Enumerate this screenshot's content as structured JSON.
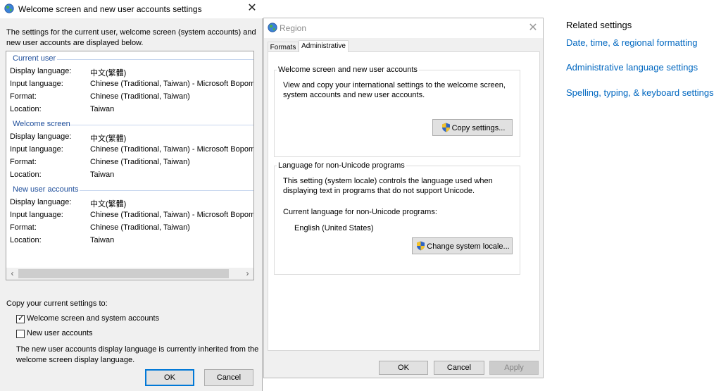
{
  "welcome_dialog": {
    "title": "Welcome screen and new user accounts settings",
    "close_glyph": "✕",
    "intro": "The settings for the current user, welcome screen (system accounts) and new user accounts are displayed below.",
    "sections": [
      {
        "header": "Current user",
        "rows": [
          {
            "label": "Display language:",
            "value": "中文(繁體)"
          },
          {
            "label": "Input language:",
            "value": "Chinese (Traditional, Taiwan) - Microsoft Bopomo"
          },
          {
            "label": "Format:",
            "value": "Chinese (Traditional, Taiwan)"
          },
          {
            "label": "Location:",
            "value": "Taiwan"
          }
        ]
      },
      {
        "header": "Welcome screen",
        "rows": [
          {
            "label": "Display language:",
            "value": "中文(繁體)"
          },
          {
            "label": "Input language:",
            "value": "Chinese (Traditional, Taiwan) - Microsoft Bopomo"
          },
          {
            "label": "Format:",
            "value": "Chinese (Traditional, Taiwan)"
          },
          {
            "label": "Location:",
            "value": "Taiwan"
          }
        ]
      },
      {
        "header": "New user accounts",
        "rows": [
          {
            "label": "Display language:",
            "value": "中文(繁體)"
          },
          {
            "label": "Input language:",
            "value": "Chinese (Traditional, Taiwan) - Microsoft Bopomo"
          },
          {
            "label": "Format:",
            "value": "Chinese (Traditional, Taiwan)"
          },
          {
            "label": "Location:",
            "value": "Taiwan"
          }
        ]
      }
    ],
    "scroll_left": "‹",
    "scroll_right": "›",
    "copy_heading": "Copy your current settings to:",
    "checkbox_welcome": {
      "label": "Welcome screen and system accounts",
      "checked": true,
      "mark": "✓"
    },
    "checkbox_new_users": {
      "label": "New user accounts",
      "checked": false
    },
    "note": "The new user accounts display language is currently inherited from the welcome screen display language.",
    "ok_label": "OK",
    "cancel_label": "Cancel"
  },
  "region_dialog": {
    "title": "Region",
    "close_glyph": "✕",
    "tabs": [
      {
        "label": "Formats",
        "active": false
      },
      {
        "label": "Administrative",
        "active": true
      }
    ],
    "welcome_group": {
      "title": "Welcome screen and new user accounts",
      "text": "View and copy your international settings to the welcome screen, system accounts and new user accounts.",
      "button": "Copy settings..."
    },
    "unicode_group": {
      "title": "Language for non-Unicode programs",
      "text": "This setting (system locale) controls the language used when displaying text in programs that do not support Unicode.",
      "current_label": "Current language for non-Unicode programs:",
      "current_value": "English (United States)",
      "button": "Change system locale..."
    },
    "ok_label": "OK",
    "cancel_label": "Cancel",
    "apply_label": "Apply"
  },
  "related_settings": {
    "heading": "Related settings",
    "links": [
      "Date, time, & regional formatting",
      "Administrative language settings",
      "Spelling, typing, & keyboard settings"
    ]
  },
  "colors": {
    "link": "#0067c0",
    "section_header": "#1e4e9b",
    "default_button_border": "#0078d7"
  },
  "icons": {
    "title": "globe-icon",
    "uac": "uac-shield-icon"
  }
}
